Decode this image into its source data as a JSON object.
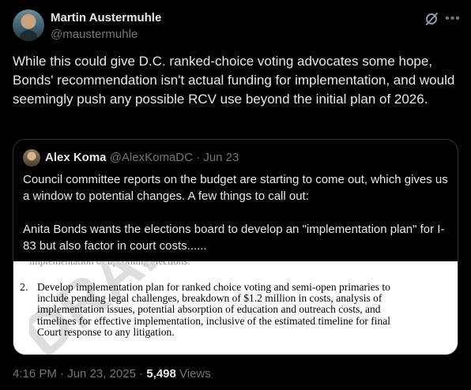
{
  "author": {
    "name": "Martin Austermuhle",
    "handle": "@maustermuhle"
  },
  "post": {
    "text": "While this could give D.C. ranked-choice voting advocates some hope, Bonds' recommendation isn't actual funding for implementation, and would seemingly push any possible RCV use beyond the initial plan of 2026."
  },
  "quote": {
    "name": "Alex Koma",
    "handle": "@AlexKomaDC",
    "separator": "·",
    "date": "Jun 23",
    "paragraph1": "Council committee reports on the budget are starting to come out, which gives us a window to potential changes. A few things to call out:",
    "paragraph2": "Anita Bonds wants the elections board to develop an \"implementation plan\" for I-83 but also factor in court costs......",
    "document": {
      "cut_line": "implementation of upcoming elections.",
      "number": "2.",
      "text": "Develop implementation plan for ranked choice voting and semi-open primaries to include pending legal challenges, breakdown of $1.2 million in costs, analysis of implementation issues, potential absorption of education and outreach costs, and timelines for effective implementation, inclusive of the estimated timeline for final Court response to any litigation.",
      "watermark": "DRAFT"
    }
  },
  "footer": {
    "time": "4:16 PM",
    "sep1": " · ",
    "date": "Jun 23, 2025",
    "sep2": " · ",
    "views_count": "5,498",
    "views_label": " Views"
  },
  "icons": {
    "grok": "grok-icon",
    "more": "more-icon"
  },
  "colors": {
    "background": "#000000",
    "text": "#e7e9ea",
    "secondary": "#71767b",
    "border": "#2f3336"
  }
}
